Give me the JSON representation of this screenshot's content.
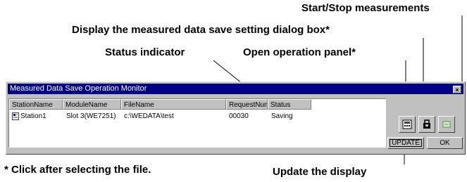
{
  "callouts": {
    "start_stop": "Start/Stop measurements",
    "save_setting": "Display the measured data save setting dialog box*",
    "status_indicator": "Status indicator",
    "operation_panel": "Open operation panel*",
    "footnote": "* Click after selecting the file.",
    "update_display": "Update the display"
  },
  "window": {
    "title": "Measured Data Save Operation Monitor",
    "close_glyph": "×"
  },
  "list": {
    "columns": [
      "StationName",
      "ModuleName",
      "FileName",
      "RequestNum",
      "Status"
    ],
    "rows": [
      {
        "station": "Station1",
        "module": "Slot 3(WE7251)",
        "file": "c:\\WEDATA\\test",
        "request": "00030",
        "status": "Saving"
      }
    ]
  },
  "buttons": {
    "update": "UPDATE",
    "ok": "OK"
  },
  "colors": {
    "status_circle": "#e0283c",
    "titlebar": "#000080",
    "face": "#c0c0c0"
  }
}
